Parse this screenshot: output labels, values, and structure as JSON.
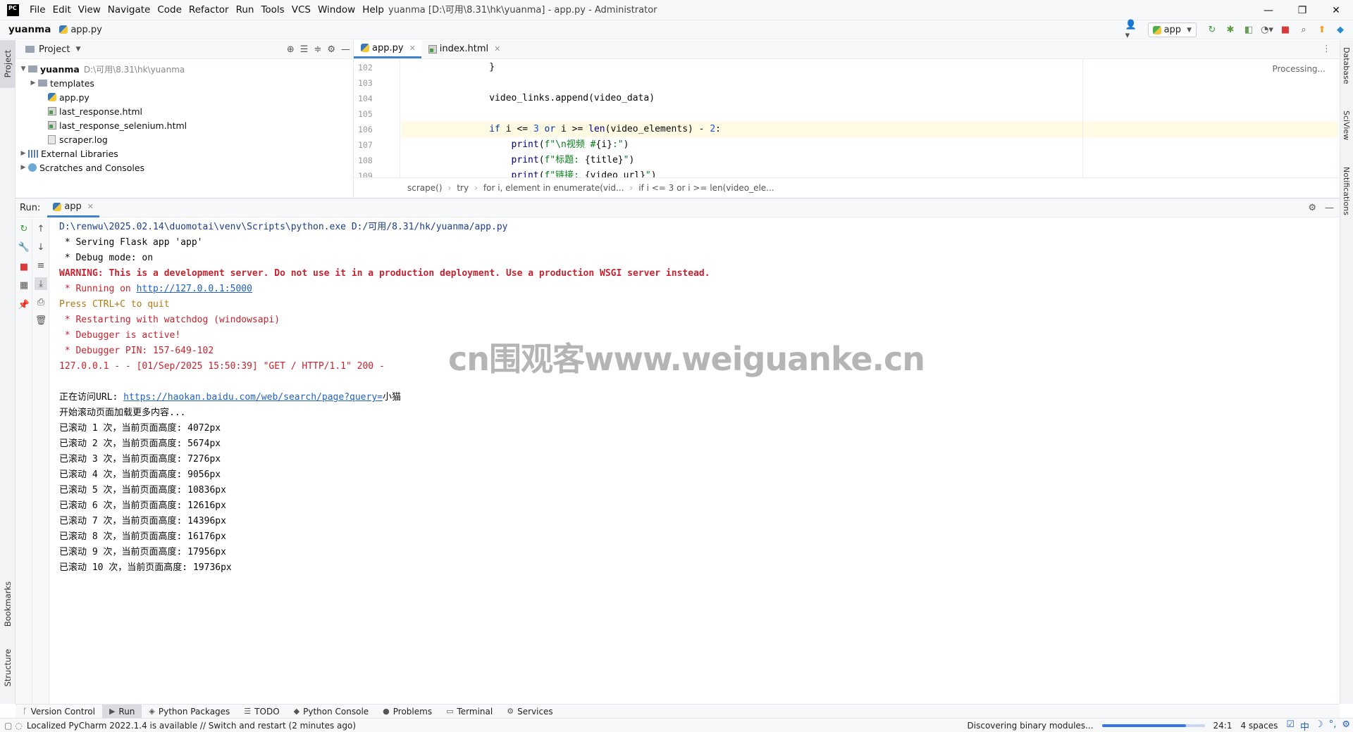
{
  "titlebar": {
    "logo": "PC",
    "menu": [
      "File",
      "Edit",
      "View",
      "Navigate",
      "Code",
      "Refactor",
      "Run",
      "Tools",
      "VCS",
      "Window",
      "Help"
    ],
    "title": "yuanma [D:\\可用\\8.31\\hk\\yuanma] - app.py - Administrator",
    "minimize": "—",
    "maximize": "❐",
    "close": "✕"
  },
  "navbar": {
    "project": "yuanma",
    "file": "app.py",
    "run_config": "app"
  },
  "stripe": {
    "project": "Project",
    "bookmarks": "Bookmarks",
    "structure": "Structure",
    "database": "Database",
    "sciview": "SciView",
    "notifications": "Notifications"
  },
  "project_panel": {
    "title": "Project",
    "root": {
      "name": "yuanma",
      "path": "D:\\可用\\8.31\\hk\\yuanma"
    },
    "items": [
      {
        "name": "templates",
        "type": "folder"
      },
      {
        "name": "app.py",
        "type": "py"
      },
      {
        "name": "last_response.html",
        "type": "html"
      },
      {
        "name": "last_response_selenium.html",
        "type": "html"
      },
      {
        "name": "scraper.log",
        "type": "log"
      }
    ],
    "external_libraries": "External Libraries",
    "scratches": "Scratches and Consoles"
  },
  "editor": {
    "tabs": [
      {
        "label": "app.py",
        "active": true
      },
      {
        "label": "index.html",
        "active": false
      }
    ],
    "line_numbers": [
      "102",
      "103",
      "104",
      "105",
      "106",
      "107",
      "108",
      "109"
    ],
    "processing": "Processing...",
    "breadcrumbs": [
      "scrape()",
      "try",
      "for i, element in enumerate(vid...",
      "if i <= 3 or i >= len(video_ele..."
    ]
  },
  "run": {
    "label": "Run:",
    "tab": "app",
    "console": {
      "cmd": "D:\\renwu\\2025.02.14\\duomotai\\venv\\Scripts\\python.exe D:/可用/8.31/hk/yuanma/app.py",
      "serving": " * Serving Flask app 'app'",
      "debug": " * Debug mode: on",
      "warning": "WARNING: This is a development server. Do not use it in a production deployment. Use a production WSGI server instead.",
      "running_prefix": " * Running on ",
      "running_url": "http://127.0.0.1:5000",
      "ctrl_c": "Press CTRL+C to quit",
      "restarting": " * Restarting with watchdog (windowsapi)",
      "debugger_active": " * Debugger is active!",
      "debugger_pin": " * Debugger PIN: 157-649-102",
      "request": "127.0.0.1 - - [01/Sep/2025 15:50:39] \"GET / HTTP/1.1\" 200 -",
      "visiting_prefix": "正在访问URL: ",
      "visiting_url": "https://haokan.baidu.com/web/search/page?query=",
      "visiting_suffix": "小猫",
      "scroll_start": "开始滚动页面加载更多内容...",
      "scroll_lines": [
        "已滚动 1 次，当前页面高度: 4072px",
        "已滚动 2 次，当前页面高度: 5674px",
        "已滚动 3 次，当前页面高度: 7276px",
        "已滚动 4 次，当前页面高度: 9056px",
        "已滚动 5 次，当前页面高度: 10836px",
        "已滚动 6 次，当前页面高度: 12616px",
        "已滚动 7 次，当前页面高度: 14396px",
        "已滚动 8 次，当前页面高度: 16176px",
        "已滚动 9 次，当前页面高度: 17956px",
        "已滚动 10 次，当前页面高度: 19736px"
      ]
    }
  },
  "watermark": "cn围观客www.weiguanke.cn",
  "bottom_tabs": [
    "Version Control",
    "Run",
    "Python Packages",
    "TODO",
    "Python Console",
    "Problems",
    "Terminal",
    "Services"
  ],
  "status": {
    "message": "Localized PyCharm 2022.1.4 is available // Switch and restart (2 minutes ago)",
    "task": "Discovering binary modules...",
    "progress": 0.82,
    "position": "24:1",
    "indent": "4 spaces",
    "ime": [
      "中",
      "☽",
      "°,",
      "⚙"
    ]
  },
  "colors": {
    "accent": "#4083c9",
    "warning": "#c7222d",
    "link": "#2160c4"
  }
}
